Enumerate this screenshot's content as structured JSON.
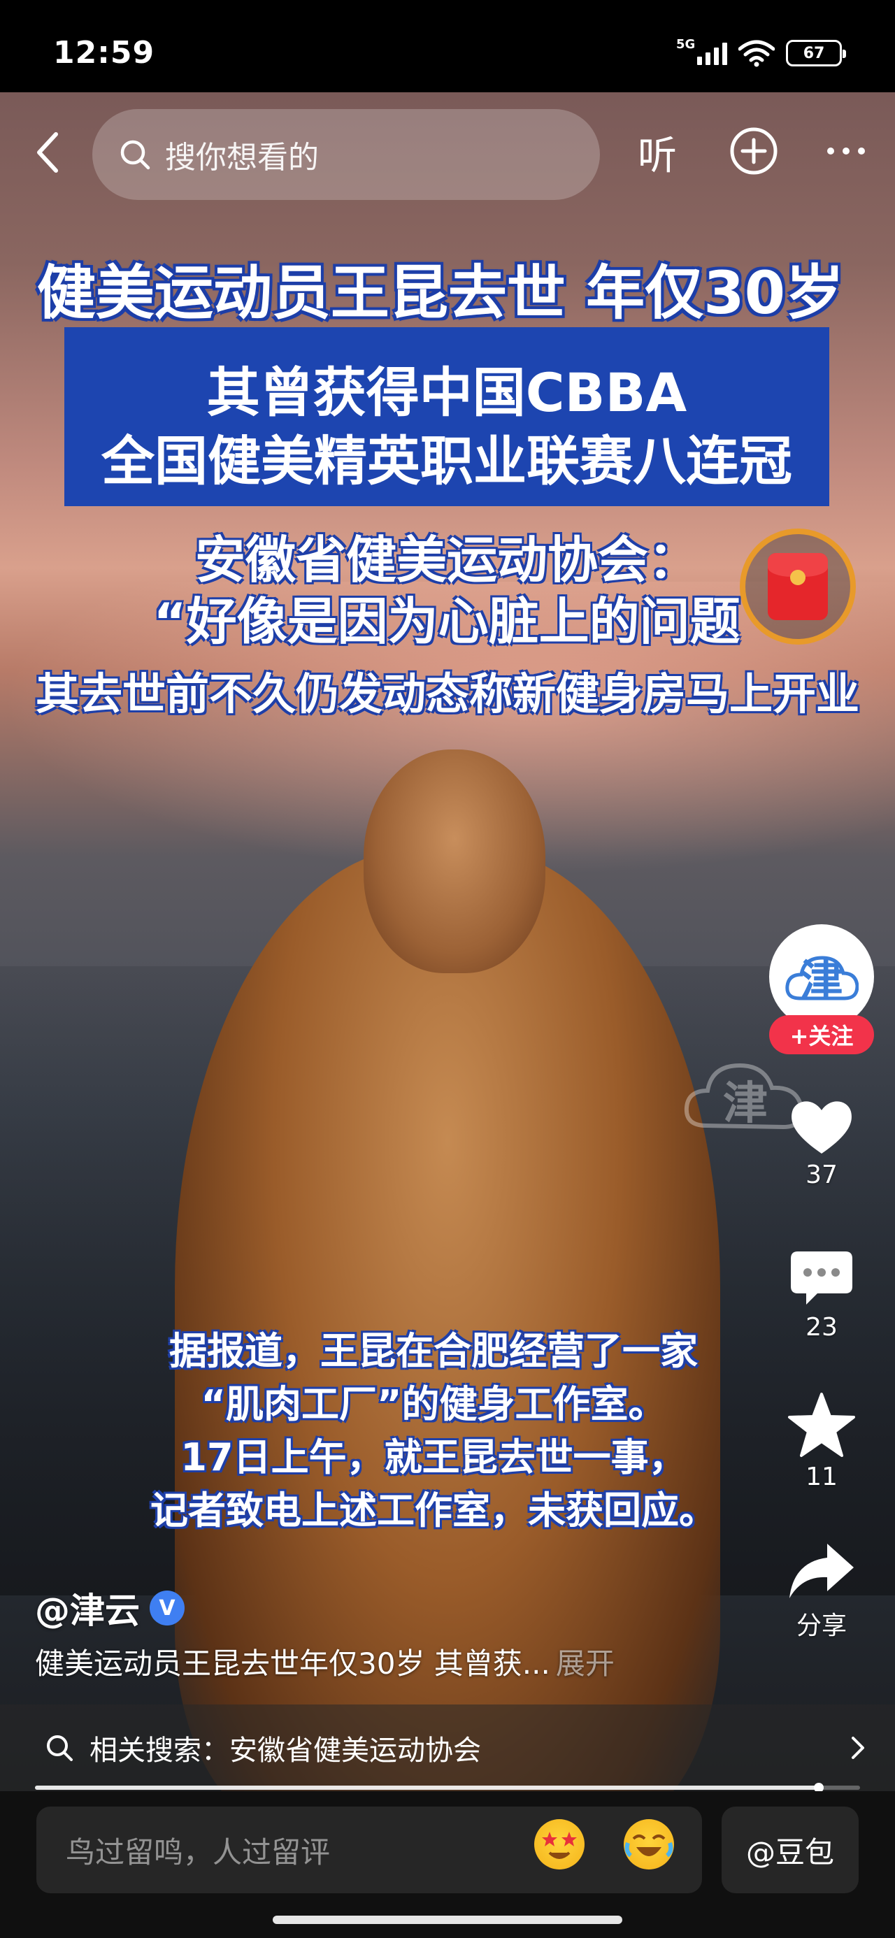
{
  "status_bar": {
    "time": "12:59",
    "network": "5G",
    "battery": "67",
    "icons": [
      "signal-icon",
      "wifi-icon",
      "battery-icon"
    ]
  },
  "top_bar": {
    "search_placeholder": "搜你想看的",
    "listen_label": "听",
    "icons": [
      "back-icon",
      "search-icon",
      "add-icon",
      "more-icon"
    ]
  },
  "video": {
    "headline": "健美运动员王昆去世 年仅30岁",
    "box_line1": "其曾获得中国CBBA",
    "box_line2": "全国健美精英职业联赛八连冠",
    "association_line1": "安徽省健美运动协会：",
    "association_line2": "“好像是因为心脏上的问题",
    "gym_line": "其去世前不久仍发动态称新健身房马上开业",
    "subtitles": [
      "据报道，王昆在合肥经营了一家",
      "“肌肉工厂”的健身工作室。",
      "17日上午，就王昆去世一事，",
      "记者致电上述工作室，未获回应。"
    ],
    "watermark_char": "津"
  },
  "side_actions": {
    "avatar_char": "津",
    "follow_label": "+关注",
    "like_count": "37",
    "comment_count": "23",
    "favorite_count": "11",
    "share_label": "分享"
  },
  "post": {
    "author": "@津云",
    "verified_mark": "V",
    "description": "健美运动员王昆去世年仅30岁 其曾获...",
    "expand_label": "展开"
  },
  "related_search": {
    "text": "相关搜索：安徽省健美运动协会"
  },
  "playback": {
    "progress": 0.95
  },
  "bottom_bar": {
    "comment_placeholder": "鸟过留鸣，人过留评",
    "doubao_label": "@豆包",
    "emojis": [
      "star-eyes-emoji",
      "laughing-emoji"
    ]
  },
  "colors": {
    "caption_blue": "#1d45b0",
    "follow_red": "#f2334a",
    "verified_blue": "#3f7ff2",
    "redpacket_ring": "#e89a2a"
  }
}
